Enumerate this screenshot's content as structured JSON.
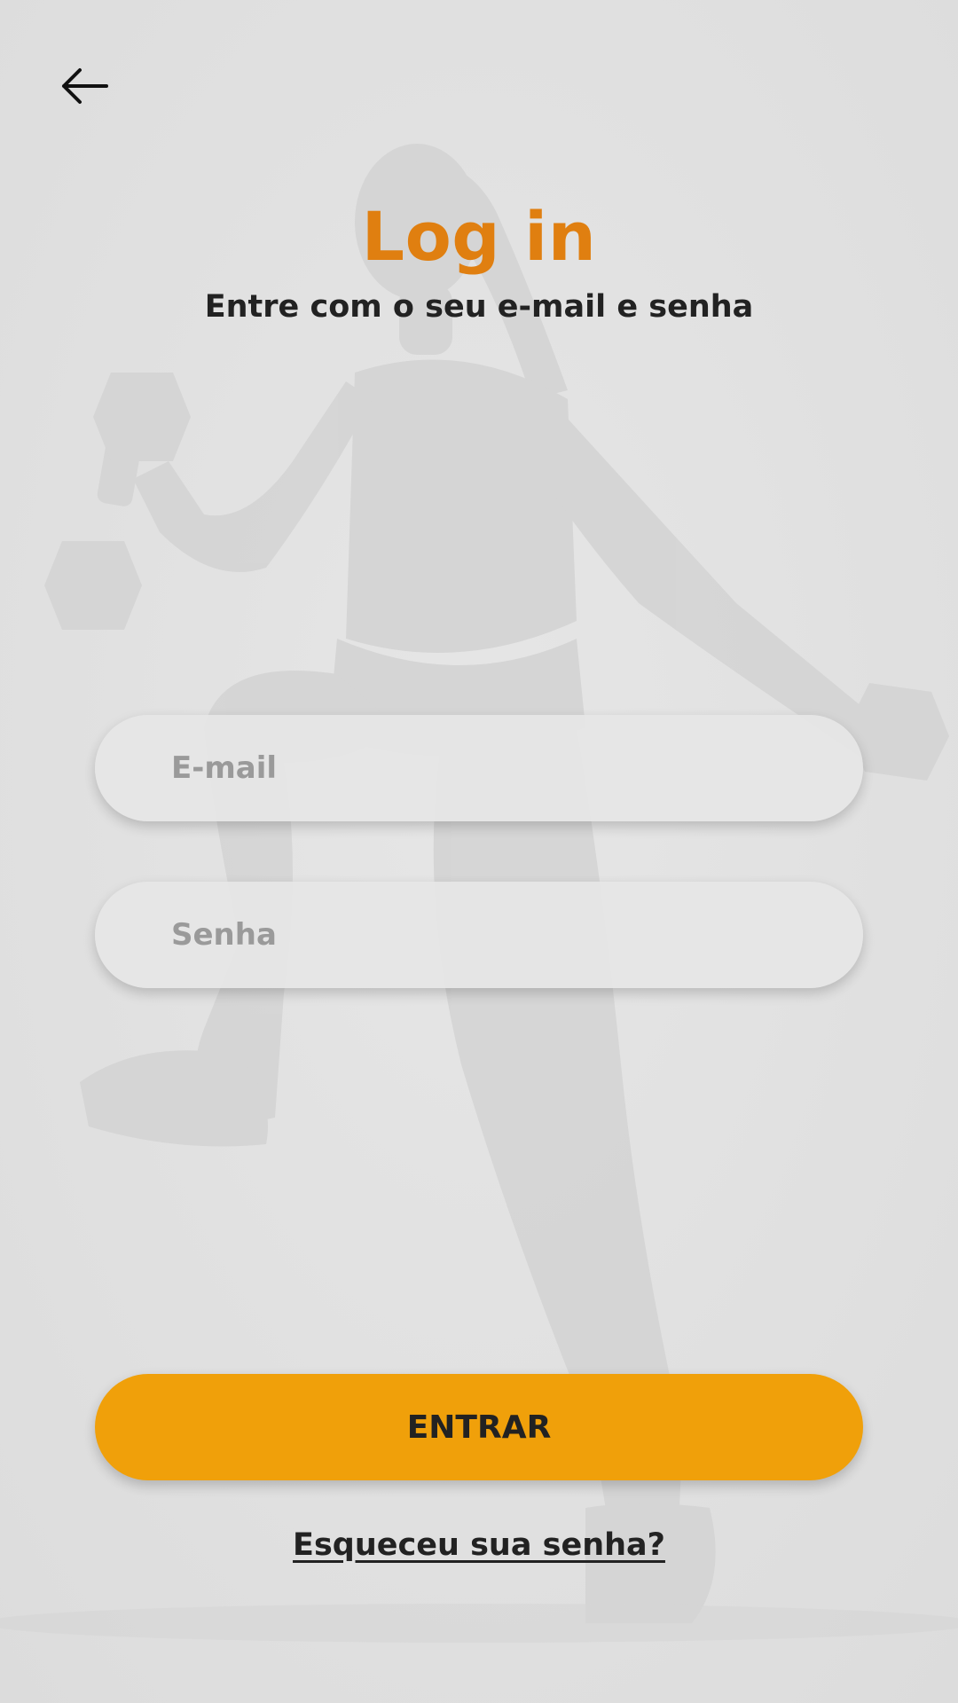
{
  "screen": {
    "title": "Log in",
    "subtitle": "Entre com o seu e-mail e senha"
  },
  "form": {
    "email_placeholder": "E-mail",
    "email_value": "",
    "password_placeholder": "Senha",
    "password_value": ""
  },
  "actions": {
    "submit_label": "ENTRAR",
    "forgot_password_label": "Esqueceu sua senha?"
  },
  "icons": {
    "back": "arrow-left-icon"
  },
  "colors": {
    "title": "#e07f10",
    "primary_button": "#f0a00a",
    "background": "#e3e3e3",
    "text_dark": "#222222",
    "placeholder": "#9a9a9a"
  }
}
